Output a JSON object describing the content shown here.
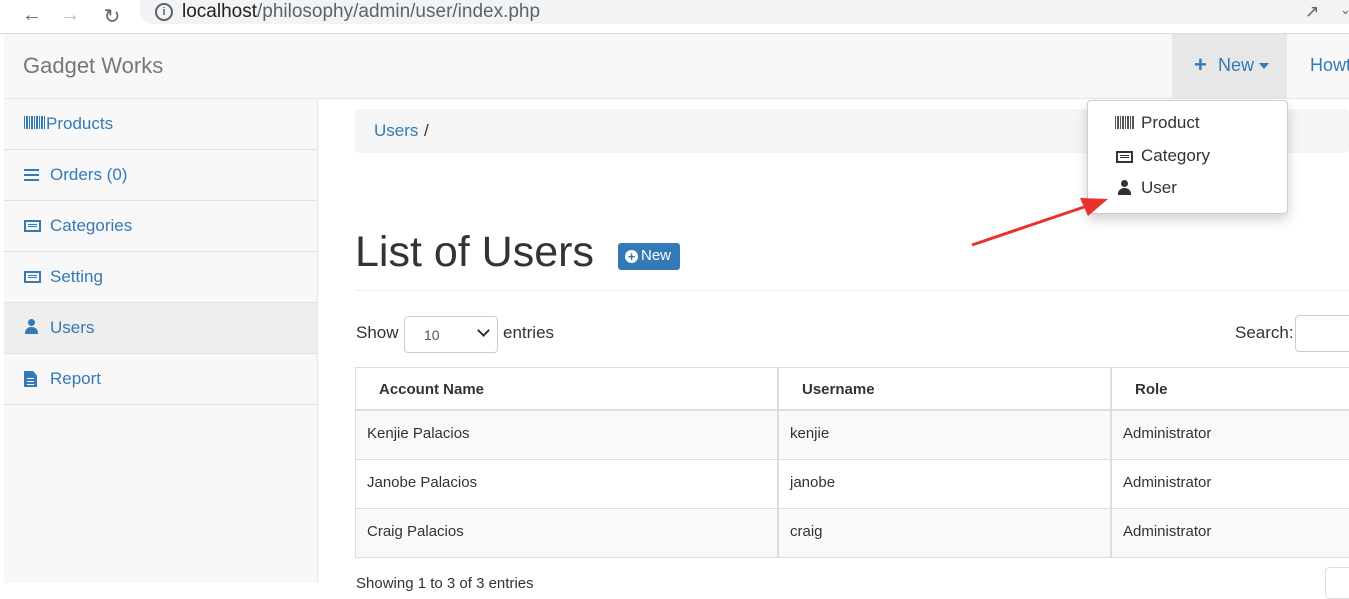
{
  "browser": {
    "url_host": "localhost",
    "url_path": "/philosophy/admin/user/index.php"
  },
  "navbar": {
    "brand": "Gadget Works",
    "new_label": "New",
    "howto_label": "Howt"
  },
  "new_menu": {
    "items": [
      {
        "label": "Product",
        "icon": "barcode-icon"
      },
      {
        "label": "Category",
        "icon": "list-alt-icon"
      },
      {
        "label": "User",
        "icon": "user-icon"
      }
    ]
  },
  "sidebar": {
    "items": [
      {
        "label": "Products",
        "icon": "barcode-icon"
      },
      {
        "label": "Orders (0)",
        "icon": "bars-icon"
      },
      {
        "label": "Categories",
        "icon": "list-alt-icon"
      },
      {
        "label": "Setting",
        "icon": "list-alt-icon"
      },
      {
        "label": "Users",
        "icon": "user-icon",
        "active": true
      },
      {
        "label": "Report",
        "icon": "file-icon"
      }
    ]
  },
  "breadcrumb": {
    "item": "Users",
    "separator": "/"
  },
  "main": {
    "title": "List of Users",
    "new_button": "New",
    "show_label": "Show",
    "entries_value": "10",
    "entries_label": "entries",
    "search_label": "Search:"
  },
  "table": {
    "headers": [
      "Account Name",
      "Username",
      "Role"
    ],
    "rows": [
      [
        "Kenjie Palacios",
        "kenjie",
        "Administrator"
      ],
      [
        "Janobe Palacios",
        "janobe",
        "Administrator"
      ],
      [
        "Craig Palacios",
        "craig",
        "Administrator"
      ]
    ]
  },
  "footer": {
    "info": "Showing 1 to 3 of 3 entries"
  },
  "colors": {
    "link": "#337ab7",
    "annotation_arrow": "#e8322b"
  }
}
